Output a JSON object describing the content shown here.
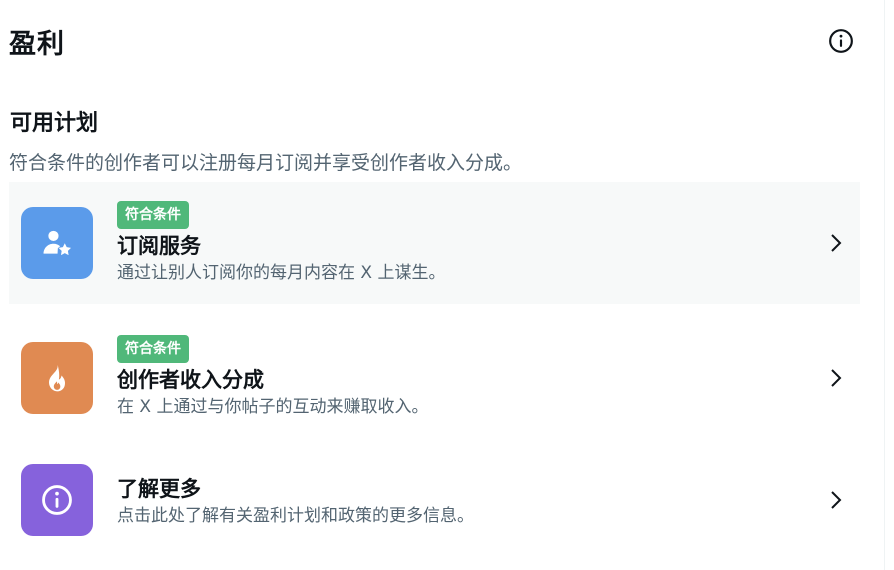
{
  "header": {
    "title": "盈利",
    "info_icon": "info-circle-icon"
  },
  "section": {
    "title": "可用计划",
    "description": "符合条件的创作者可以注册每月订阅并享受创作者收入分成。"
  },
  "plans": [
    {
      "badge": "符合条件",
      "title": "订阅服务",
      "description": "通过让别人订阅你的每月内容在 X 上谋生。",
      "icon": "person-star-icon",
      "tile_color": "#5b9bea",
      "highlighted": true
    },
    {
      "badge": "符合条件",
      "title": "创作者收入分成",
      "description": "在 X 上通过与你帖子的互动来赚取收入。",
      "icon": "flame-icon",
      "tile_color": "#e08a52",
      "highlighted": false
    },
    {
      "title": "了解更多",
      "description": "点击此处了解有关盈利计划和政策的更多信息。",
      "icon": "info-circle-icon",
      "tile_color": "#8662dc",
      "highlighted": false
    }
  ],
  "colors": {
    "badge_green": "#50b87a",
    "secondary_text": "#536471",
    "highlight_bg": "#f7f9f9"
  }
}
